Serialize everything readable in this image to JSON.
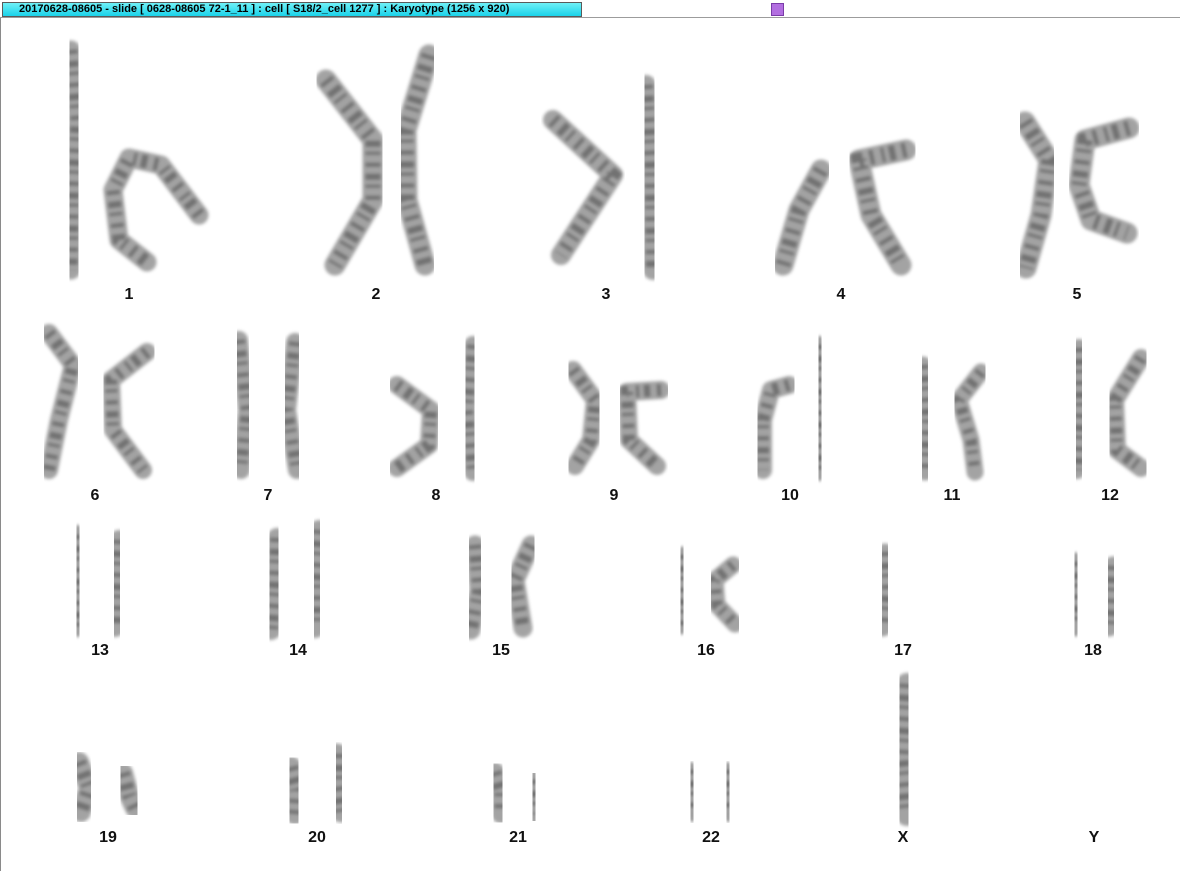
{
  "window": {
    "title": "20170628-08605 - slide [ 0628-08605 72-1_11 ] : cell [ S18/2_cell 1277 ] : Karyotype  (1256 x 920)"
  },
  "karyotype": {
    "chromosomes": [
      {
        "label": "1"
      },
      {
        "label": "2"
      },
      {
        "label": "3"
      },
      {
        "label": "4"
      },
      {
        "label": "5"
      },
      {
        "label": "6"
      },
      {
        "label": "7"
      },
      {
        "label": "8"
      },
      {
        "label": "9"
      },
      {
        "label": "10"
      },
      {
        "label": "11"
      },
      {
        "label": "12"
      },
      {
        "label": "13"
      },
      {
        "label": "14"
      },
      {
        "label": "15"
      },
      {
        "label": "16"
      },
      {
        "label": "17"
      },
      {
        "label": "18"
      },
      {
        "label": "19"
      },
      {
        "label": "20"
      },
      {
        "label": "21"
      },
      {
        "label": "22"
      },
      {
        "label": "X"
      },
      {
        "label": "Y"
      }
    ]
  },
  "colors": {
    "title_tab": "#1ad2ea",
    "marker": "#b26ee0",
    "chromosome": "#8a8a8a",
    "band": "#4a4a4a"
  }
}
